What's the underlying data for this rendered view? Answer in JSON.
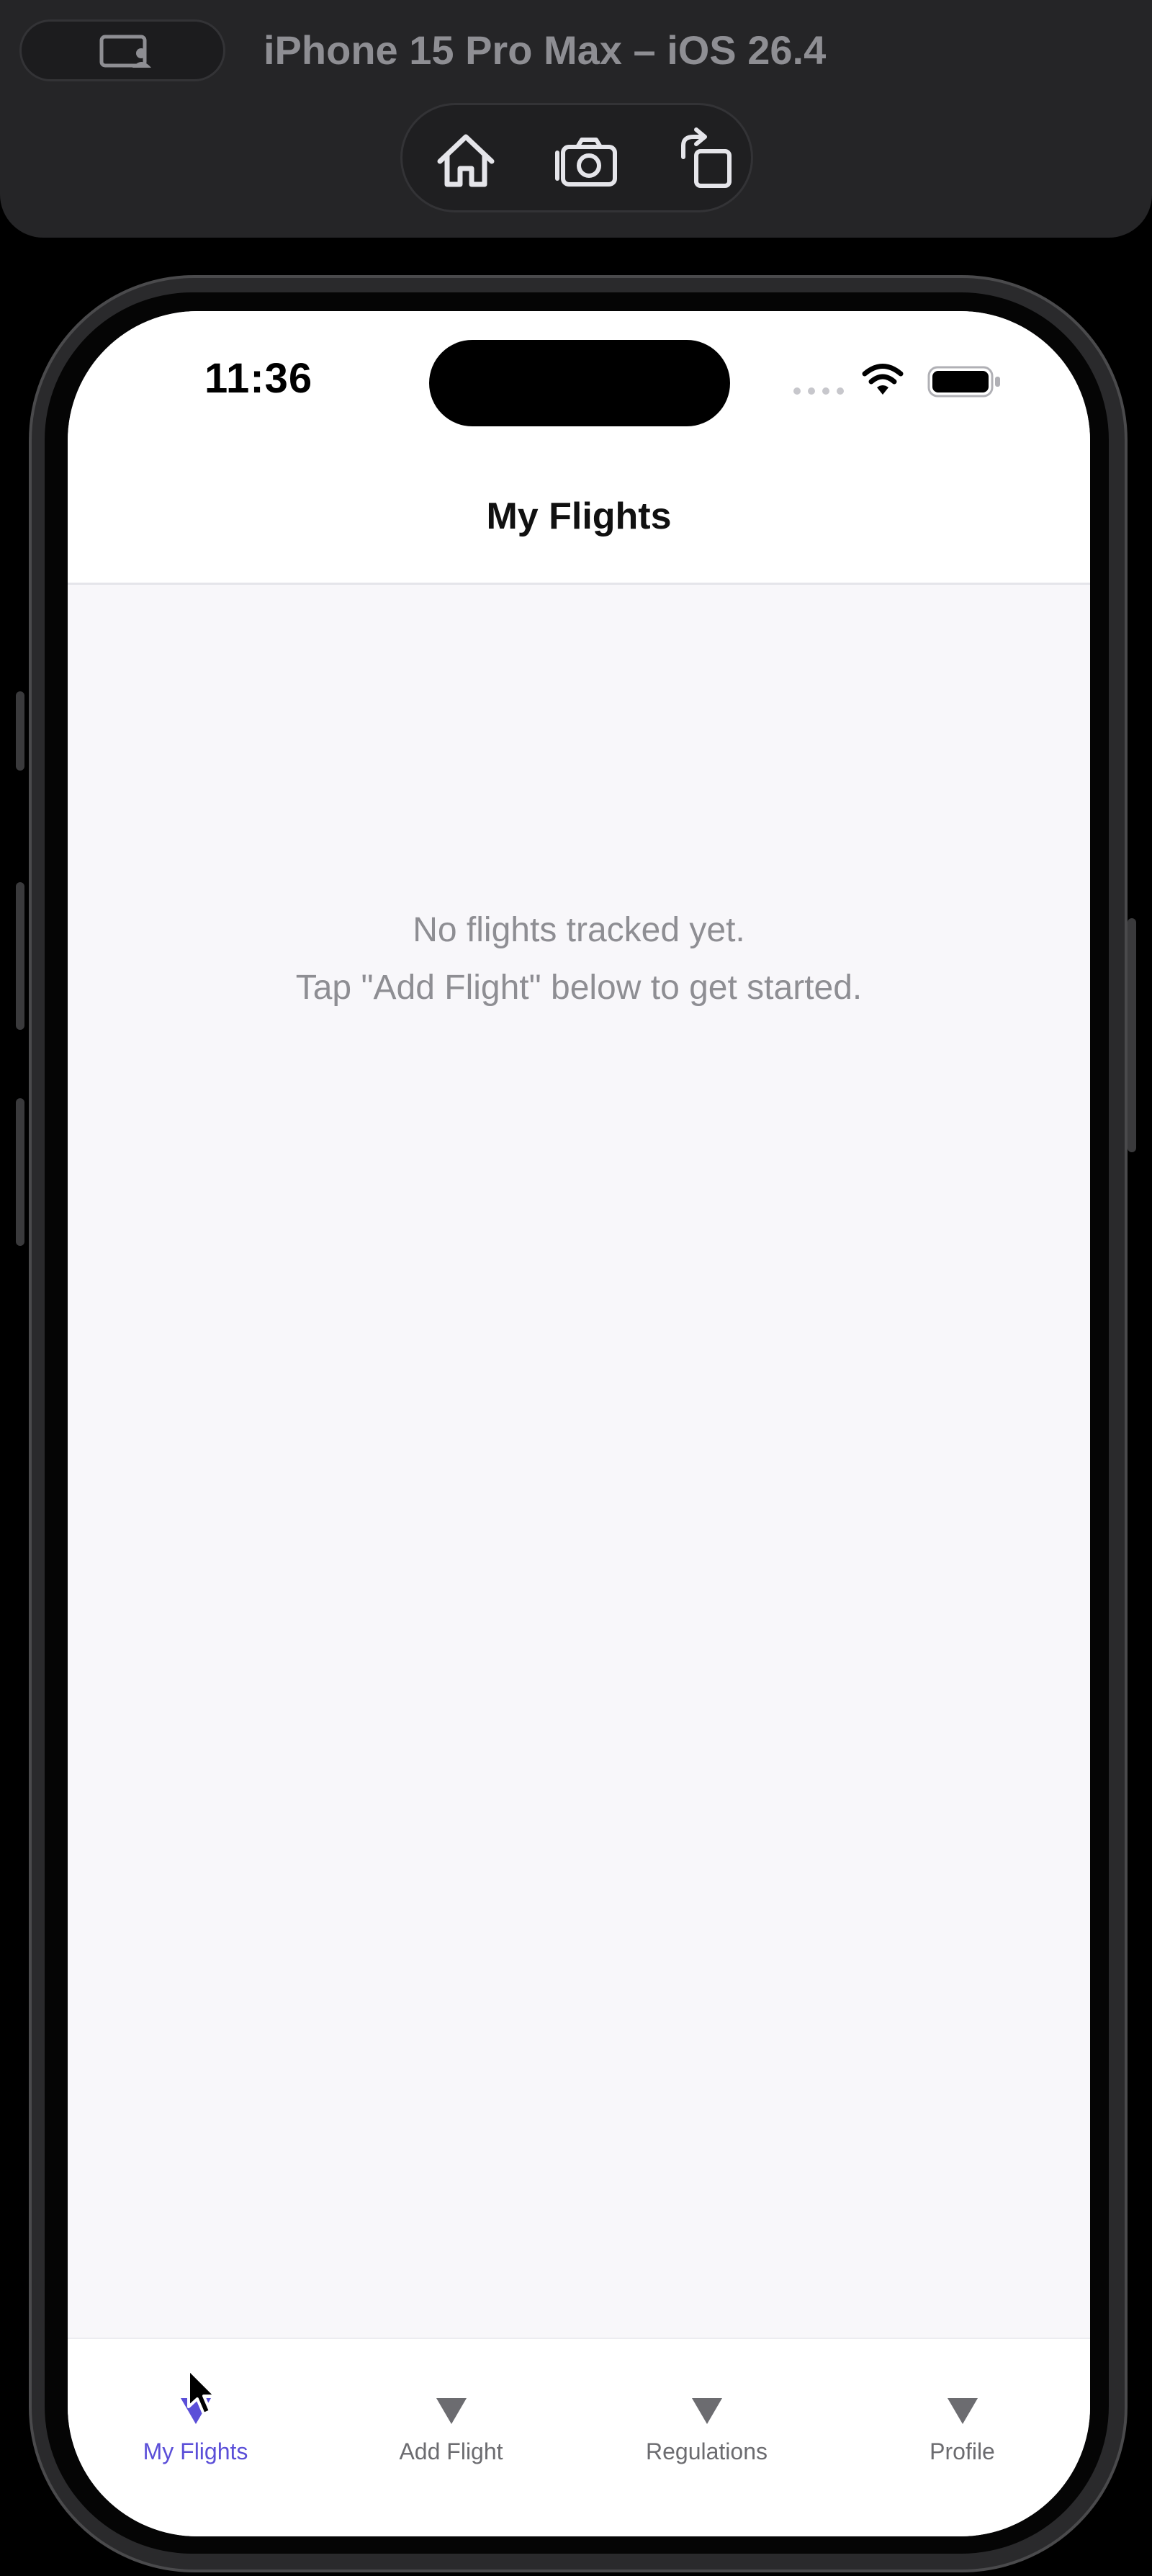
{
  "simulator": {
    "title": "iPhone 15 Pro Max – iOS 26.4",
    "controls": [
      {
        "icon": "home-icon"
      },
      {
        "icon": "screenshot-icon"
      },
      {
        "icon": "rotate-icon"
      }
    ]
  },
  "status_bar": {
    "time": "11:36"
  },
  "nav": {
    "title": "My Flights"
  },
  "empty_state": {
    "line1": "No flights tracked yet.",
    "line2": "Tap \"Add Flight\" below to get started."
  },
  "tabs": [
    {
      "label": "My Flights",
      "icon": "triangle-down-icon",
      "active": true
    },
    {
      "label": "Add Flight",
      "icon": "triangle-down-icon",
      "active": false
    },
    {
      "label": "Regulations",
      "icon": "triangle-down-icon",
      "active": false
    },
    {
      "label": "Profile",
      "icon": "triangle-down-icon",
      "active": false
    }
  ],
  "colors": {
    "accent": "#5b4fd8",
    "inactive_tab": "#6c6c70",
    "empty_text": "#8e8e93",
    "screen_bg": "#f8f7fa"
  }
}
